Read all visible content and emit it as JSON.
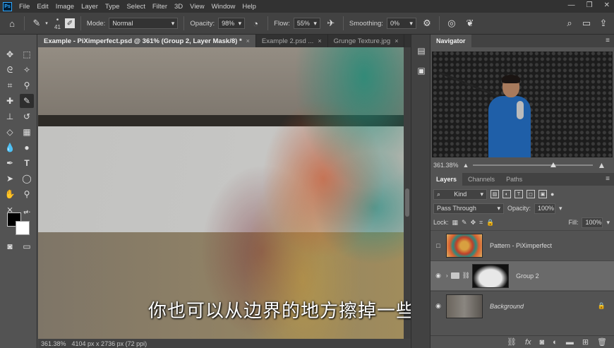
{
  "menubar": {
    "logo": "Ps",
    "items": [
      "File",
      "Edit",
      "Image",
      "Layer",
      "Type",
      "Select",
      "Filter",
      "3D",
      "View",
      "Window",
      "Help"
    ],
    "window_buttons": [
      "—",
      "❐",
      "✕"
    ]
  },
  "options": {
    "brush_size": "41",
    "mode_label": "Mode:",
    "mode_value": "Normal",
    "opacity_label": "Opacity:",
    "opacity_value": "98%",
    "flow_label": "Flow:",
    "flow_value": "55%",
    "smoothing_label": "Smoothing:",
    "smoothing_value": "0%"
  },
  "tabs": [
    {
      "label": "Example - PiXimperfect.psd @ 361% (Group 2, Layer Mask/8) *",
      "close": "×"
    },
    {
      "label": "Example 2.psd ...",
      "close": "×"
    },
    {
      "label": "Grunge Texture.jpg",
      "close": "×"
    }
  ],
  "status": {
    "zoom": "361.38%",
    "doc_size": "4104 px x 2736 px (72 ppi)"
  },
  "subtitle": "你也可以从边界的地方擦掉一些",
  "navigator": {
    "title": "Navigator",
    "zoom": "361.38%"
  },
  "layers": {
    "tabs": [
      "Layers",
      "Channels",
      "Paths"
    ],
    "kind_label": "Kind",
    "blend_mode": "Pass Through",
    "opacity_label": "Opacity:",
    "opacity_value": "100%",
    "lock_label": "Lock:",
    "fill_label": "Fill:",
    "fill_value": "100%",
    "items": [
      {
        "name": "Pattern - PiXimperfect"
      },
      {
        "name": "Group 2"
      },
      {
        "name": "Background"
      }
    ]
  },
  "icons": [
    "home-icon",
    "brush-icon",
    "move-icon",
    "marquee-icon",
    "lasso-icon",
    "magic-wand-icon",
    "crop-icon",
    "eyedropper-icon",
    "healing-icon",
    "brush-tool-icon",
    "stamp-icon",
    "history-brush-icon",
    "eraser-icon",
    "gradient-icon",
    "blur-icon",
    "dodge-icon",
    "pen-icon",
    "type-icon",
    "path-select-icon",
    "shape-icon",
    "hand-icon",
    "zoom-icon",
    "search-icon",
    "settings-icon"
  ]
}
